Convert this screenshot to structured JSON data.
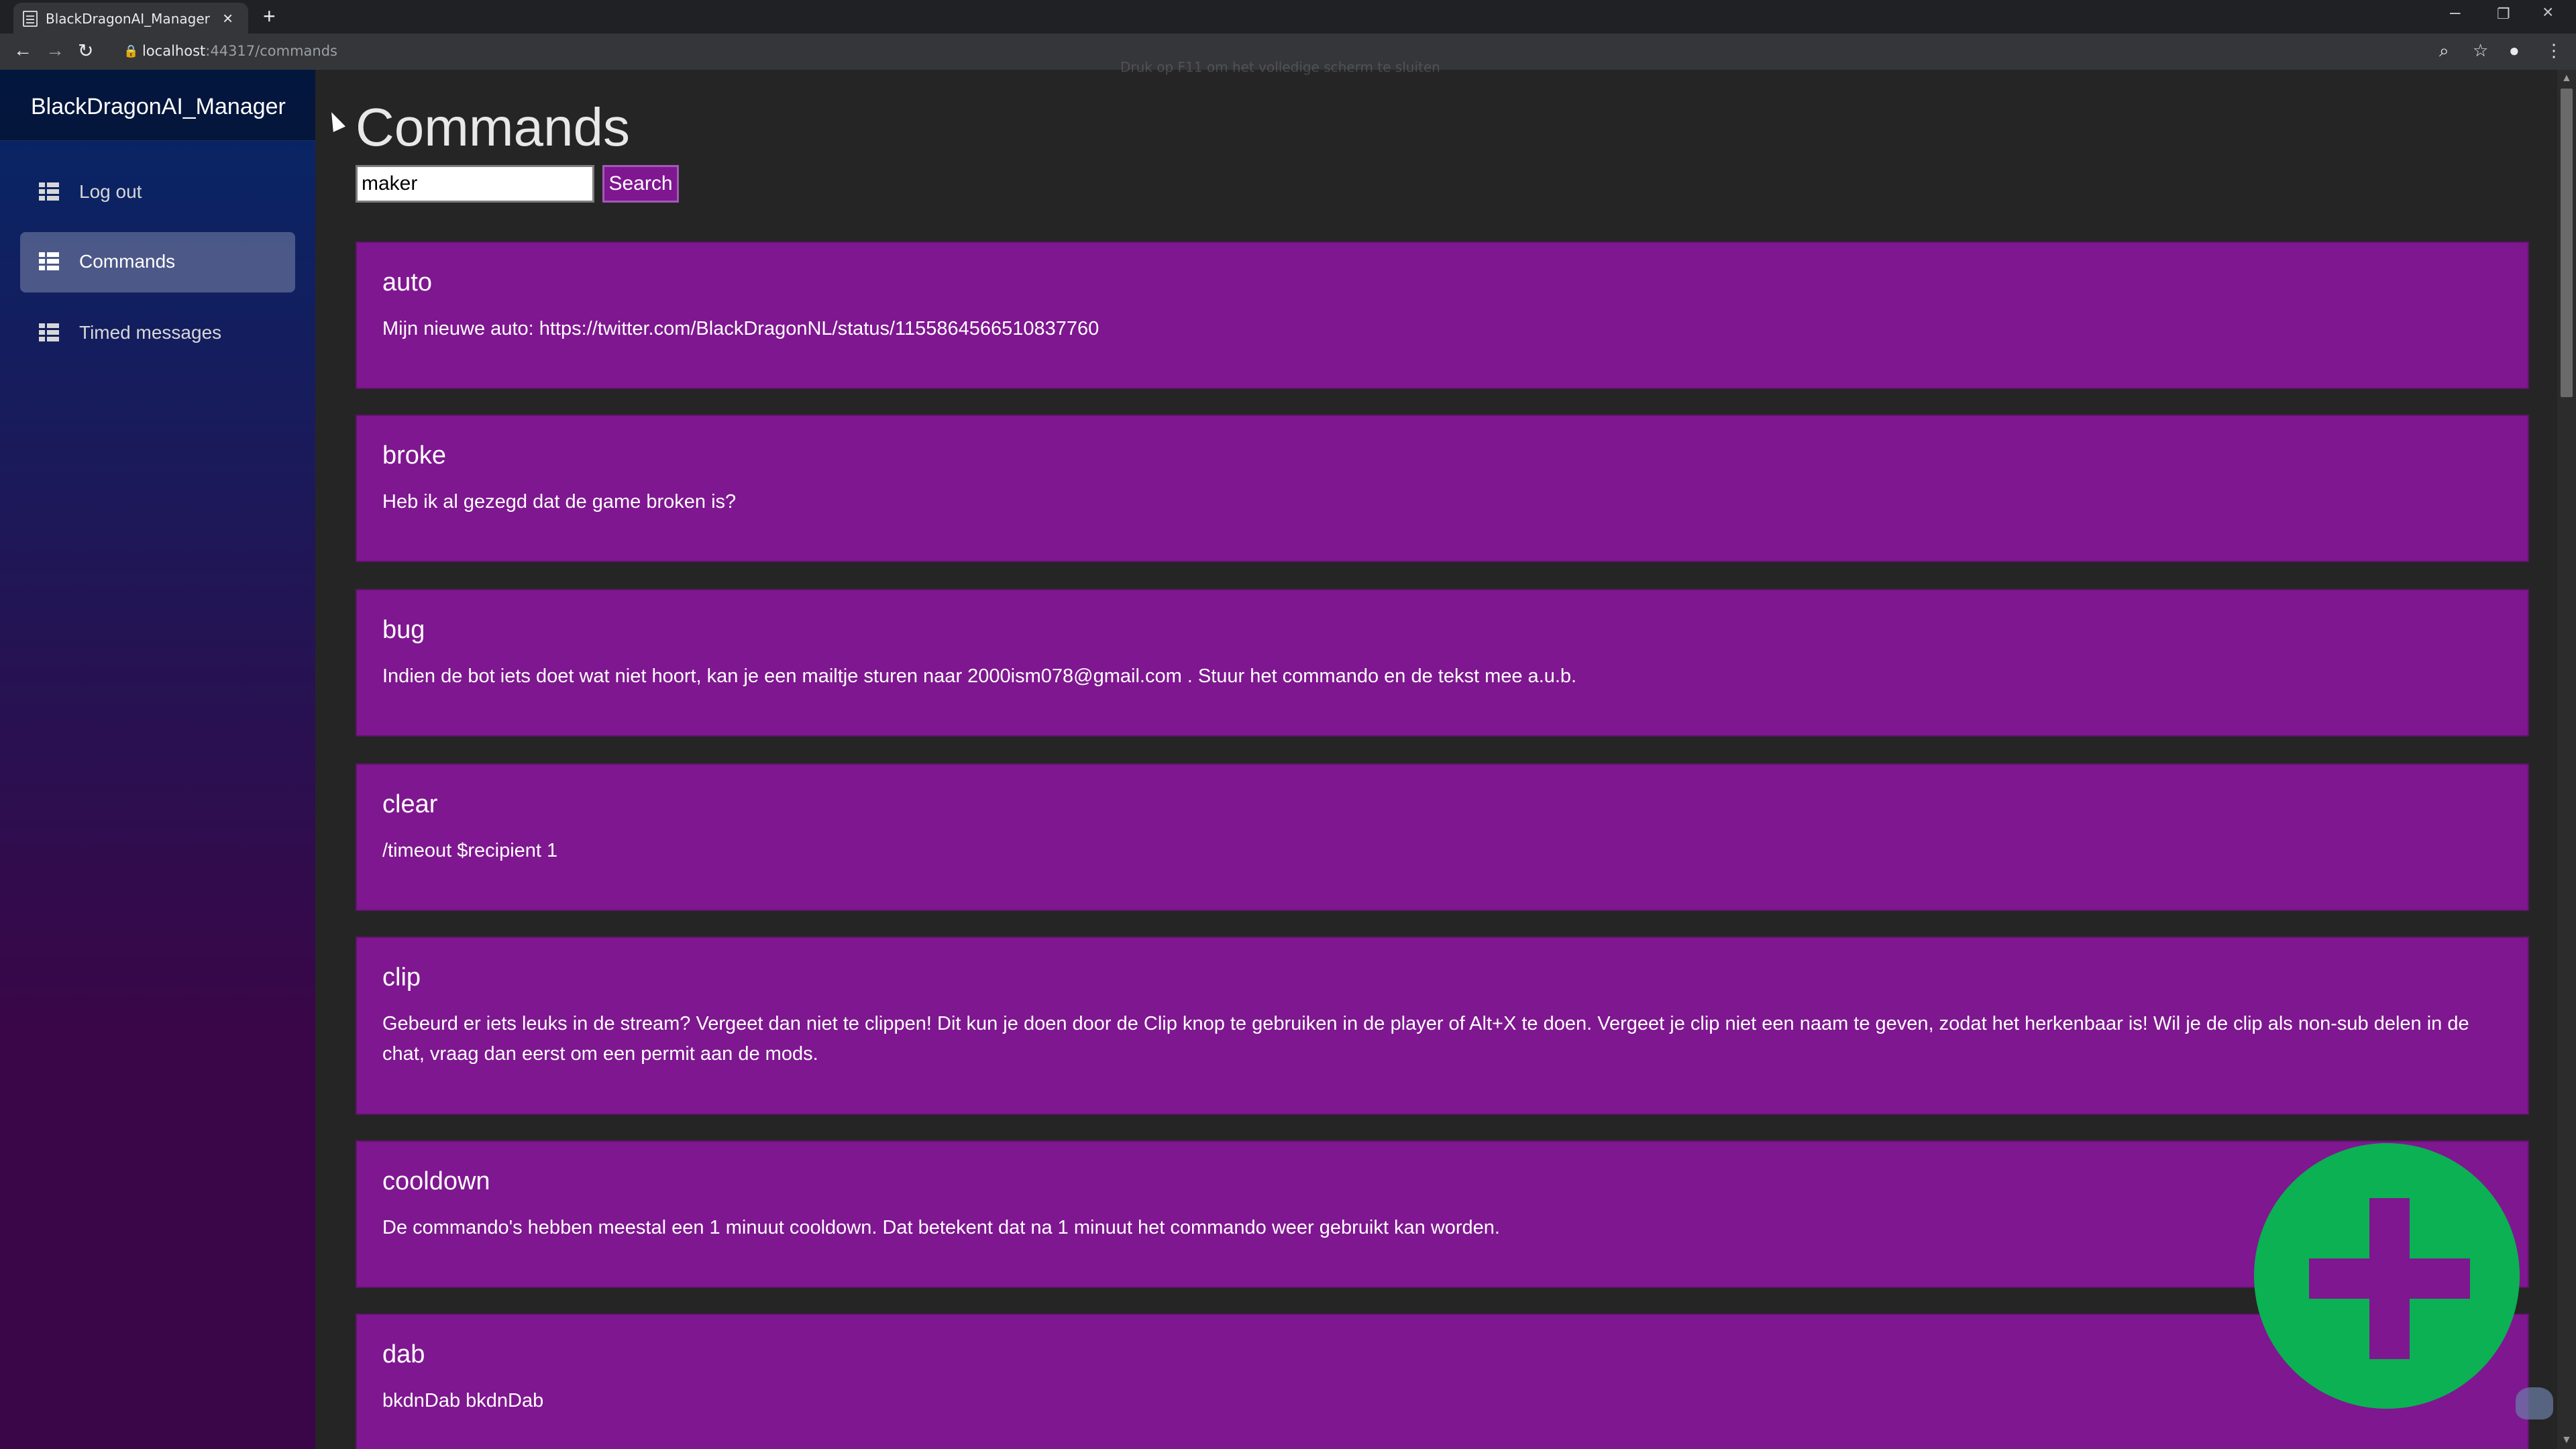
{
  "browser": {
    "tab_title": "BlackDragonAI_Manager",
    "url_host": "localhost",
    "url_rest": ":44317/commands",
    "fullscreen_hint": "Druk op  F11  om het volledige scherm te sluiten"
  },
  "sidebar": {
    "brand": "BlackDragonAI_Manager",
    "items": [
      {
        "label": "Log out"
      },
      {
        "label": "Commands",
        "active": true
      },
      {
        "label": "Timed messages"
      }
    ]
  },
  "main": {
    "title": "Commands",
    "search": {
      "value": "maker",
      "button": "Search"
    },
    "commands": [
      {
        "name": "auto",
        "text": "Mijn nieuwe auto: https://twitter.com/BlackDragonNL/status/1155864566510837760"
      },
      {
        "name": "broke",
        "text": "Heb ik al gezegd dat de game broken is?"
      },
      {
        "name": "bug",
        "text": "Indien de bot iets doet wat niet hoort, kan je een mailtje sturen naar 2000ism078@gmail.com . Stuur het commando en de tekst mee a.u.b."
      },
      {
        "name": "clear",
        "text": "/timeout $recipient 1"
      },
      {
        "name": "clip",
        "text": "Gebeurd er iets leuks in de stream? Vergeet dan niet te clippen! Dit kun je doen door de Clip knop te gebruiken in de player of Alt+X te doen. Vergeet je clip niet een naam te geven, zodat het herkenbaar is! Wil je de clip als non-sub delen in de chat, vraag dan eerst om een permit aan de mods."
      },
      {
        "name": "cooldown",
        "text": "De commando's hebben meestal een 1 minuut cooldown. Dat betekent dat na 1 minuut het commando weer gebruikt kan worden."
      },
      {
        "name": "dab",
        "text": "bkdnDab bkdnDab"
      }
    ]
  },
  "colors": {
    "card": "#7f1790",
    "fab": "#0bb152",
    "sidebar_top": "#052767",
    "sidebar_bottom": "#3a0647"
  }
}
